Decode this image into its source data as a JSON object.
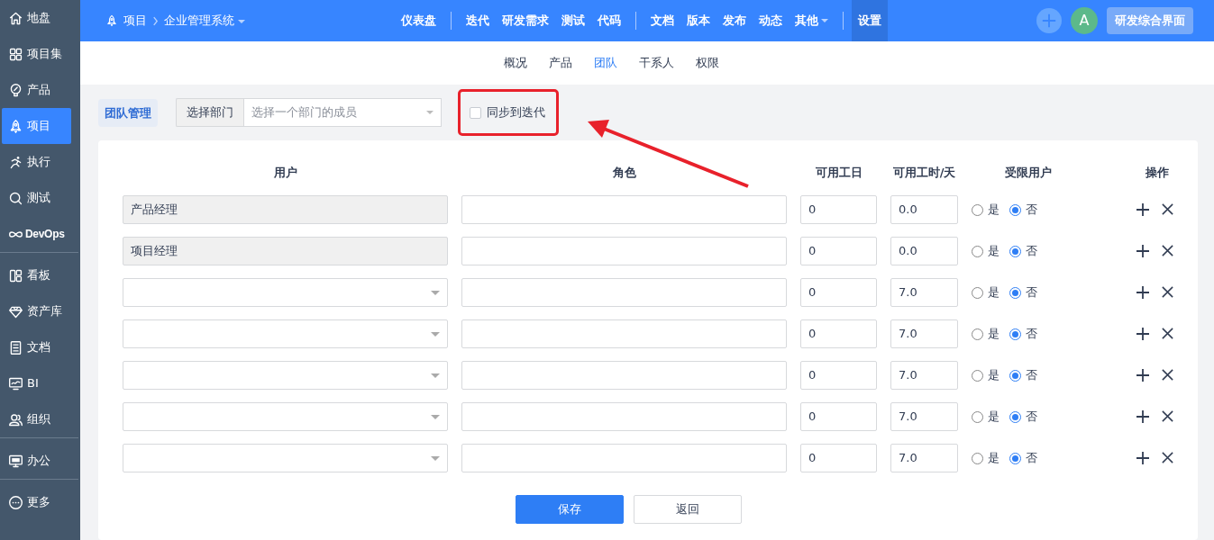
{
  "sidebar": {
    "groups": [
      [
        {
          "label": "地盘",
          "selected": false
        },
        {
          "label": "项目集",
          "selected": false
        },
        {
          "label": "产品",
          "selected": false
        },
        {
          "label": "项目",
          "selected": true
        },
        {
          "label": "执行",
          "selected": false
        },
        {
          "label": "测试",
          "selected": false
        },
        {
          "label": "DevOps",
          "selected": false
        }
      ],
      [
        {
          "label": "看板",
          "selected": false
        },
        {
          "label": "资产库",
          "selected": false
        },
        {
          "label": "文档",
          "selected": false
        },
        {
          "label": "BI",
          "selected": false
        },
        {
          "label": "组织",
          "selected": false
        }
      ],
      [
        {
          "label": "办公",
          "selected": false
        }
      ],
      [
        {
          "label": "更多",
          "selected": false
        }
      ]
    ]
  },
  "topbar": {
    "breadcrumb_root": "项目",
    "breadcrumb_current": "企业管理系统",
    "menu_groups": [
      [
        {
          "label": "仪表盘",
          "selected": false,
          "dropdown": false
        }
      ],
      [
        {
          "label": "迭代",
          "selected": false,
          "dropdown": false
        },
        {
          "label": "研发需求",
          "selected": false,
          "dropdown": false
        },
        {
          "label": "测试",
          "selected": false,
          "dropdown": false
        },
        {
          "label": "代码",
          "selected": false,
          "dropdown": false
        }
      ],
      [
        {
          "label": "文档",
          "selected": false,
          "dropdown": false
        },
        {
          "label": "版本",
          "selected": false,
          "dropdown": false
        },
        {
          "label": "发布",
          "selected": false,
          "dropdown": false
        },
        {
          "label": "动态",
          "selected": false,
          "dropdown": false
        },
        {
          "label": "其他",
          "selected": false,
          "dropdown": true
        }
      ],
      [
        {
          "label": "设置",
          "selected": true,
          "dropdown": false
        }
      ]
    ],
    "avatar": "A",
    "workspace_button": "研发综合界面"
  },
  "subtabs": [
    {
      "label": "概况",
      "selected": false
    },
    {
      "label": "产品",
      "selected": false
    },
    {
      "label": "团队",
      "selected": true
    },
    {
      "label": "干系人",
      "selected": false
    },
    {
      "label": "权限",
      "selected": false
    }
  ],
  "toolbar": {
    "title": "团队管理",
    "dept_label": "选择部门",
    "dept_placeholder": "选择一个部门的成员",
    "sync": {
      "label": "同步到迭代",
      "checked": false,
      "highlighted": true
    }
  },
  "table": {
    "columns": [
      "用户",
      "角色",
      "可用工日",
      "可用工时/天",
      "受限用户",
      "操作"
    ],
    "rows": [
      {
        "kind": "fixed",
        "user": "产品经理",
        "days": "0",
        "hours": "0.0",
        "options": [
          "是",
          "否"
        ],
        "limited": false
      },
      {
        "kind": "fixed",
        "user": "项目经理",
        "days": "0",
        "hours": "0.0",
        "options": [
          "是",
          "否"
        ],
        "limited": false
      },
      {
        "kind": "select",
        "days": "0",
        "hours": "7.0",
        "options": [
          "是",
          "否"
        ],
        "limited": false
      },
      {
        "kind": "select",
        "days": "0",
        "hours": "7.0",
        "options": [
          "是",
          "否"
        ],
        "limited": false
      },
      {
        "kind": "select",
        "days": "0",
        "hours": "7.0",
        "options": [
          "是",
          "否"
        ],
        "limited": false
      },
      {
        "kind": "select",
        "days": "0",
        "hours": "7.0",
        "options": [
          "是",
          "否"
        ],
        "limited": false
      },
      {
        "kind": "select",
        "days": "0",
        "hours": "7.0",
        "options": [
          "是",
          "否"
        ],
        "limited": false
      }
    ]
  },
  "buttons": [
    {
      "label": "保存",
      "kind": "primary"
    },
    {
      "label": "返回",
      "kind": "secondary"
    }
  ],
  "annotation_arrow": true
}
